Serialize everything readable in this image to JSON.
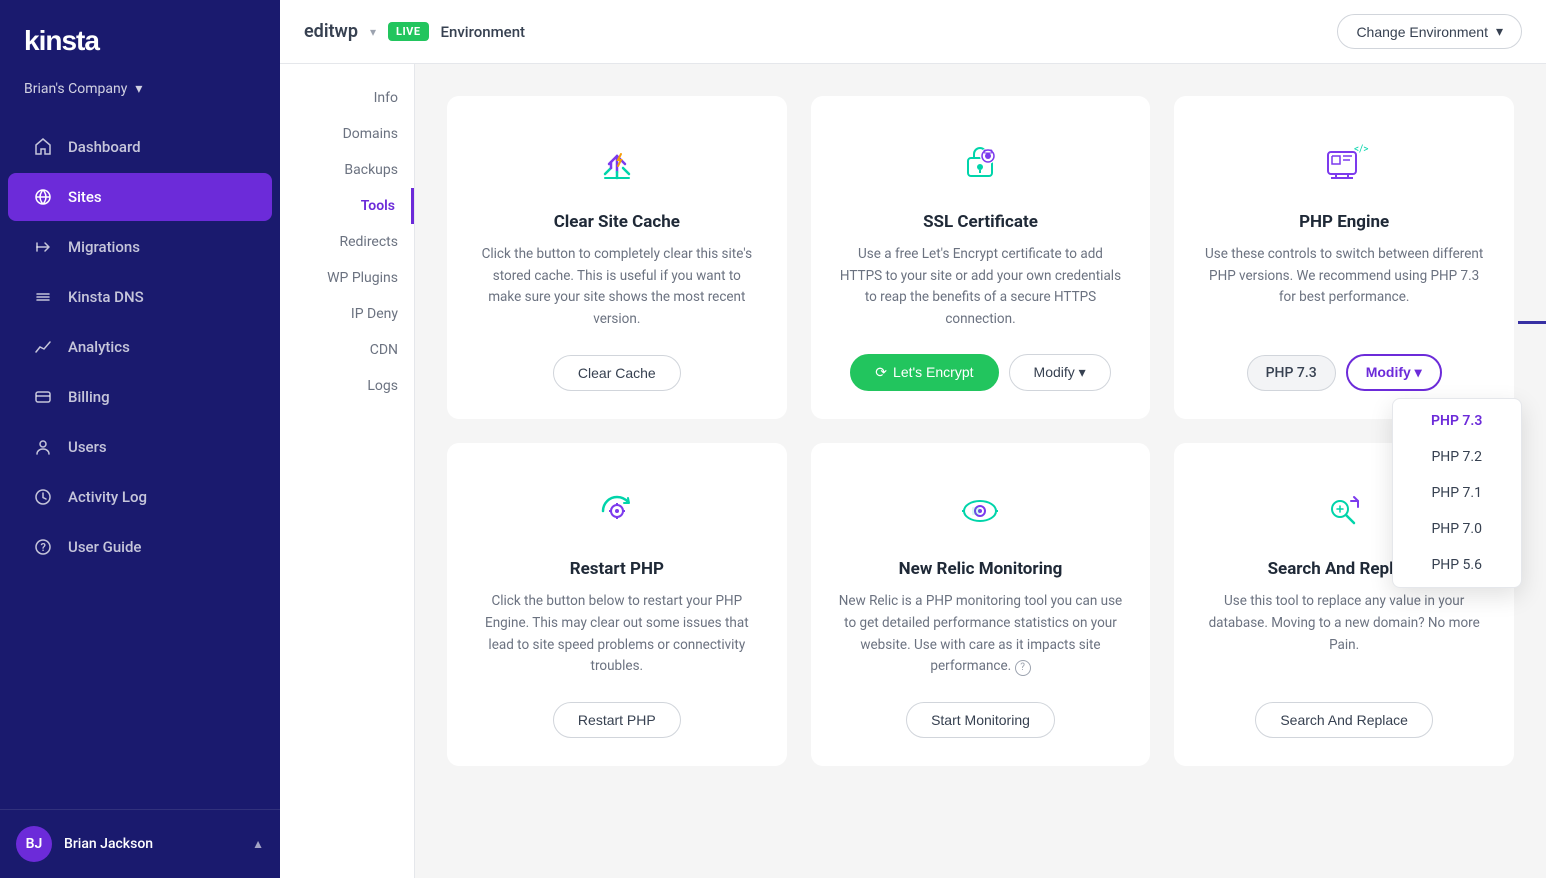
{
  "sidebar": {
    "logo": "kinsta",
    "company": "Brian's Company",
    "nav_items": [
      {
        "id": "dashboard",
        "label": "Dashboard",
        "icon": "home"
      },
      {
        "id": "sites",
        "label": "Sites",
        "icon": "sites",
        "active": true
      },
      {
        "id": "migrations",
        "label": "Migrations",
        "icon": "migrations"
      },
      {
        "id": "kinsta-dns",
        "label": "Kinsta DNS",
        "icon": "dns"
      },
      {
        "id": "analytics",
        "label": "Analytics",
        "icon": "analytics"
      },
      {
        "id": "billing",
        "label": "Billing",
        "icon": "billing"
      },
      {
        "id": "users",
        "label": "Users",
        "icon": "users"
      },
      {
        "id": "activity-log",
        "label": "Activity Log",
        "icon": "activity"
      },
      {
        "id": "user-guide",
        "label": "User Guide",
        "icon": "guide"
      }
    ],
    "user": {
      "name": "Brian Jackson",
      "initials": "BJ"
    }
  },
  "topbar": {
    "site_name": "editwp",
    "live_badge": "LIVE",
    "environment_label": "Environment",
    "change_env_btn": "Change Environment"
  },
  "secondary_nav": {
    "items": [
      {
        "label": "Info"
      },
      {
        "label": "Domains"
      },
      {
        "label": "Backups"
      },
      {
        "label": "Tools",
        "active": true
      },
      {
        "label": "Redirects"
      },
      {
        "label": "WP Plugins"
      },
      {
        "label": "IP Deny"
      },
      {
        "label": "CDN"
      },
      {
        "label": "Logs"
      }
    ]
  },
  "tools": [
    {
      "id": "clear-cache",
      "title": "Clear Site Cache",
      "description": "Click the button to completely clear this site's stored cache. This is useful if you want to make sure your site shows the most recent version.",
      "btn_label": "Clear Cache",
      "btn_type": "secondary"
    },
    {
      "id": "ssl-certificate",
      "title": "SSL Certificate",
      "description": "Use a free Let's Encrypt certificate to add HTTPS to your site or add your own credentials to reap the benefits of a secure HTTPS connection.",
      "btn_label": "Let's Encrypt",
      "btn_label2": "Modify",
      "btn_type": "primary"
    },
    {
      "id": "php-engine",
      "title": "PHP Engine",
      "description": "Use these controls to switch between different PHP versions. We recommend using PHP 7.3 for best performance.",
      "current_version": "PHP 7.3",
      "btn_label": "Modify",
      "btn_type": "modify",
      "dropdown_items": [
        "PHP 7.3",
        "PHP 7.2",
        "PHP 7.1",
        "PHP 7.0",
        "PHP 5.6"
      ]
    },
    {
      "id": "restart-php",
      "title": "Restart PHP",
      "description": "Click the button below to restart your PHP Engine. This may clear out some issues that lead to site speed problems or connectivity troubles.",
      "btn_label": "Restart PHP",
      "btn_type": "secondary"
    },
    {
      "id": "new-relic",
      "title": "New Relic Monitoring",
      "description": "New Relic is a PHP monitoring tool you can use to get detailed performance statistics on your website. Use with care as it impacts site performance.",
      "btn_label": "Start Monitoring",
      "btn_type": "secondary"
    },
    {
      "id": "search-replace",
      "title": "Search And Replace",
      "description": "Use this tool to replace any value in your database. Moving to a new domain? No more Pain.",
      "btn_label": "Search And Replace",
      "btn_type": "secondary"
    }
  ],
  "php_dropdown": {
    "items": [
      "PHP 7.3",
      "PHP 7.2",
      "PHP 7.1",
      "PHP 7.0",
      "PHP 5.6"
    ],
    "selected": "PHP 7.3"
  }
}
